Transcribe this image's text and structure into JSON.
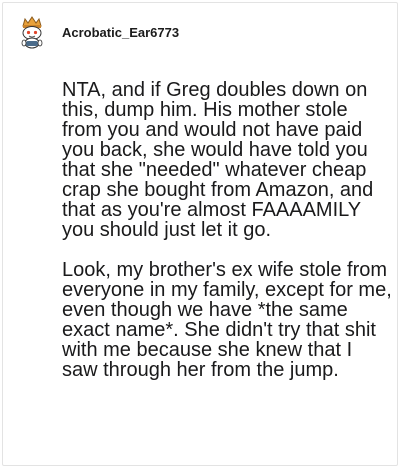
{
  "comment": {
    "username": "Acrobatic_Ear6773",
    "avatar_icon": "snoo-avatar-icon",
    "paragraphs": [
      "NTA, and if Greg doubles down on this, dump him. His mother stole from you and would not have paid you back, she would have told you that she \"needed\" whatever cheap crap she bought from Amazon, and that as you're almost FAAAAMILY you should just let it go.",
      "Look, my brother's ex wife stole from everyone in my family, except for me, even though we have *the same exact name*. She didn't try that shit with me because she knew that I saw through her from the jump."
    ]
  },
  "colors": {
    "text": "#1a1a1b",
    "border": "#e3e3e3",
    "avatar_hat": "#e8a13a"
  }
}
